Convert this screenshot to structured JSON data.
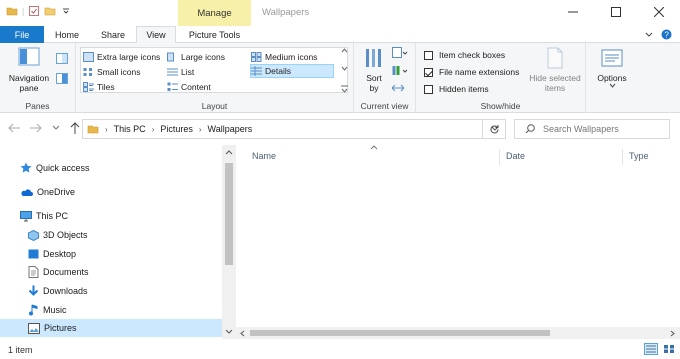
{
  "window": {
    "title": "Wallpapers",
    "manage_tab": "Manage",
    "min_icon": "minimize-icon",
    "max_icon": "maximize-icon",
    "close_icon": "close-icon"
  },
  "tabs": {
    "file": "File",
    "home": "Home",
    "share": "Share",
    "view": "View",
    "picture_tools": "Picture Tools"
  },
  "ribbon": {
    "panes": {
      "nav_pane_line1": "Navigation",
      "nav_pane_line2": "pane",
      "label": "Panes"
    },
    "layout": {
      "items": {
        "extra_large": "Extra large icons",
        "large": "Large icons",
        "medium": "Medium icons",
        "small": "Small icons",
        "list": "List",
        "details": "Details",
        "tiles": "Tiles",
        "content": "Content"
      },
      "selected": "Details",
      "label": "Layout"
    },
    "current_view": {
      "sort_line1": "Sort",
      "sort_line2": "by",
      "label": "Current view"
    },
    "show_hide": {
      "item_check_boxes": "Item check boxes",
      "item_check_boxes_checked": false,
      "file_name_extensions": "File name extensions",
      "file_name_extensions_checked": true,
      "hidden_items": "Hidden items",
      "hidden_items_checked": false,
      "hide_selected_line1": "Hide selected",
      "hide_selected_line2": "items",
      "label": "Show/hide"
    },
    "options": {
      "label": "Options"
    }
  },
  "address": {
    "crumbs": [
      "This PC",
      "Pictures",
      "Wallpapers"
    ],
    "search_placeholder": "Search Wallpapers"
  },
  "nav_pane": {
    "items": [
      {
        "label": "Quick access",
        "icon": "star-icon"
      },
      {
        "label": "OneDrive",
        "icon": "cloud-icon"
      },
      {
        "label": "This PC",
        "icon": "computer-icon"
      },
      {
        "label": "3D Objects",
        "icon": "cube-icon"
      },
      {
        "label": "Desktop",
        "icon": "desktop-icon"
      },
      {
        "label": "Documents",
        "icon": "documents-icon"
      },
      {
        "label": "Downloads",
        "icon": "download-icon"
      },
      {
        "label": "Music",
        "icon": "music-icon"
      },
      {
        "label": "Pictures",
        "icon": "pictures-icon"
      }
    ],
    "selected": "Pictures"
  },
  "file_list": {
    "columns": [
      "Name",
      "Date",
      "Type"
    ],
    "rows": []
  },
  "status": {
    "item_count": "1 item"
  },
  "colors": {
    "file_tab": "#1979ca",
    "manage_tab": "#f7f0a9",
    "selection": "#cce8ff",
    "ribbon_bg": "#f5f6f7"
  }
}
